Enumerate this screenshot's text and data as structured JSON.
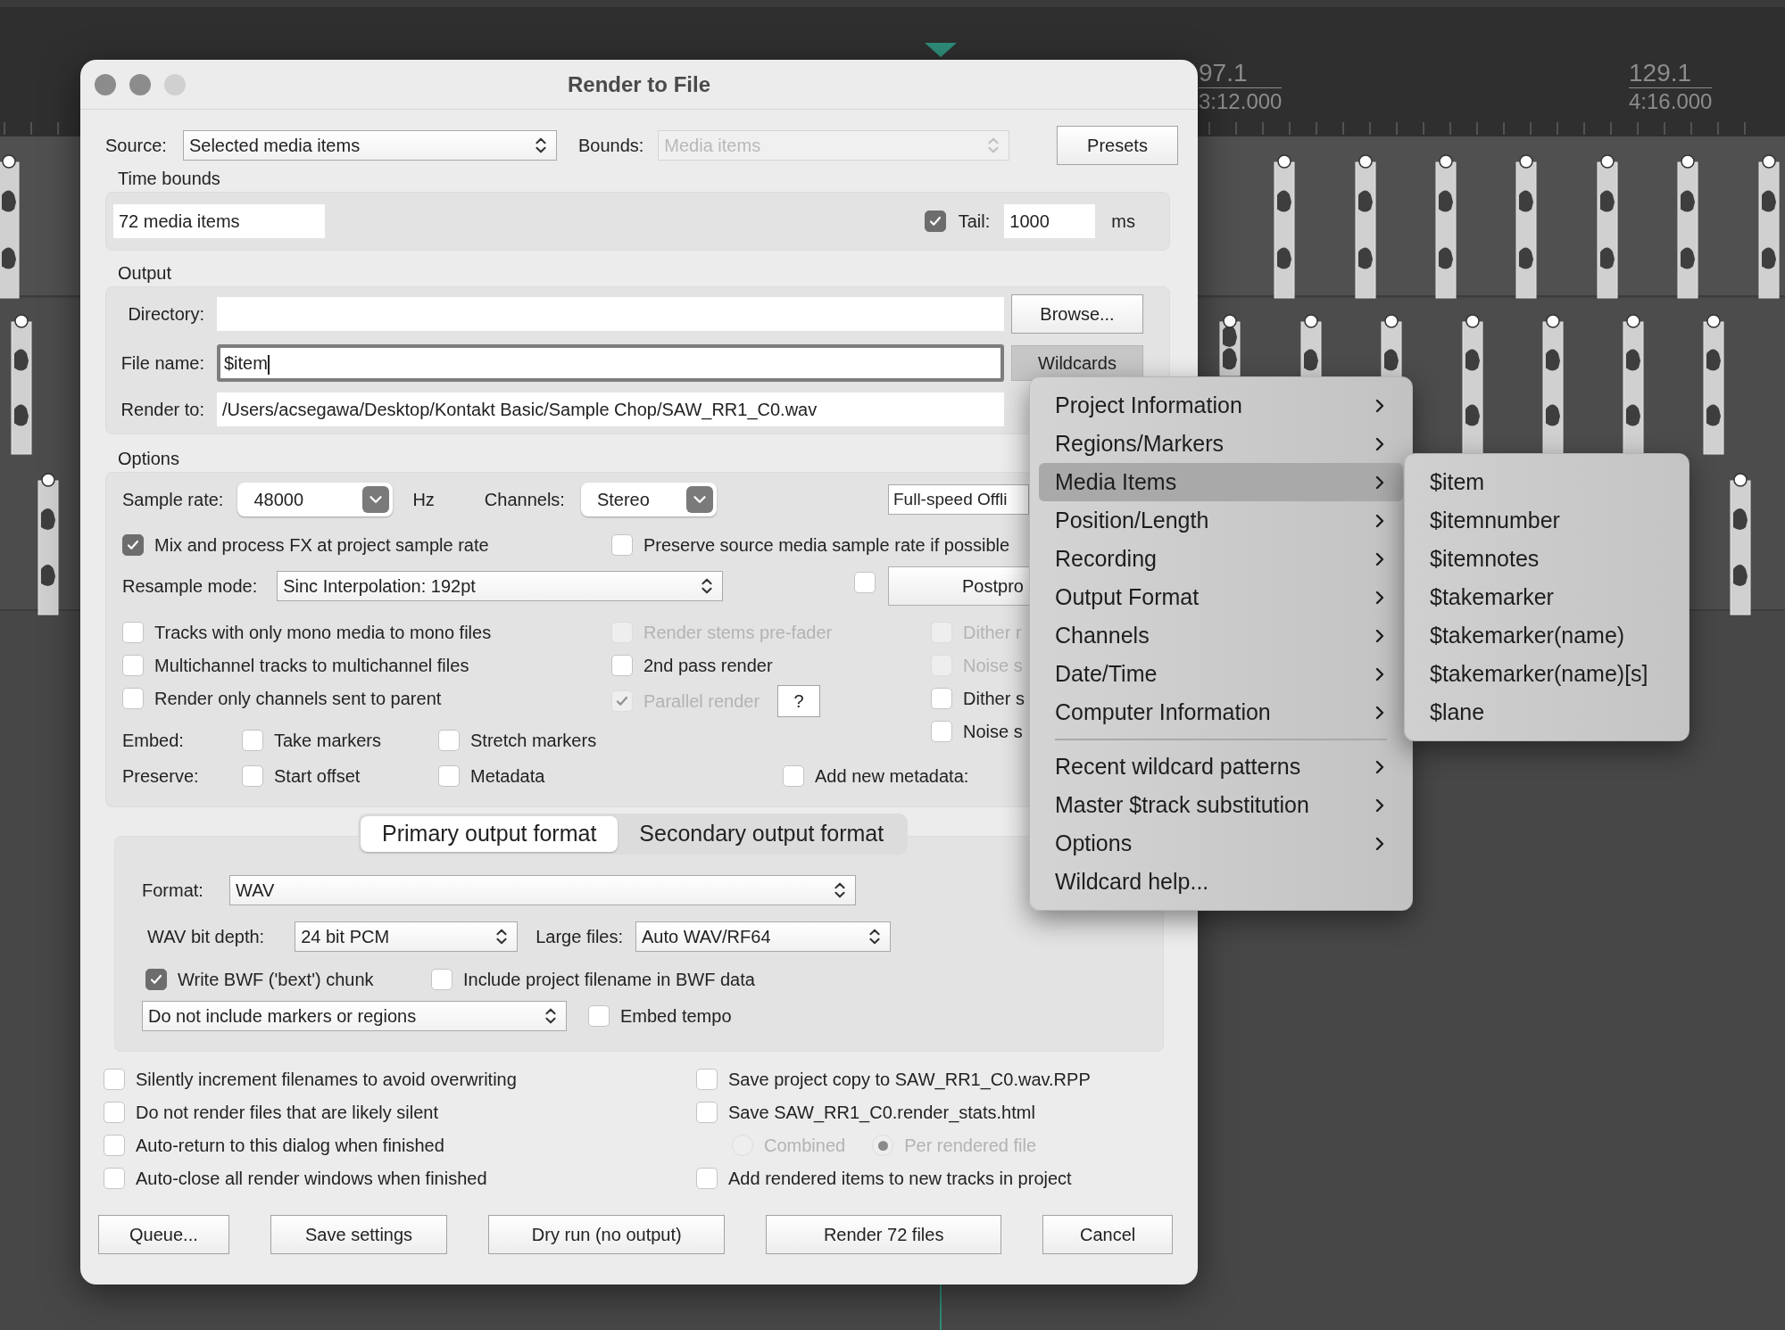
{
  "timeline": {
    "markers": [
      {
        "bar": "97.1",
        "time": "3:12.000"
      },
      {
        "bar": "129.1",
        "time": "4:16.000"
      }
    ]
  },
  "dialog": {
    "title": "Render to File",
    "source": {
      "label": "Source:",
      "value": "Selected media items"
    },
    "bounds": {
      "label": "Bounds:",
      "value": "Media items",
      "disabled": true
    },
    "presets_button": "Presets",
    "time_bounds": {
      "heading": "Time bounds",
      "range": "72 media items",
      "tail": {
        "label": "Tail:",
        "checked": true,
        "value": "1000",
        "unit": "ms"
      }
    },
    "output": {
      "heading": "Output",
      "directory": {
        "label": "Directory:"
      },
      "browse_button": "Browse...",
      "file_name": {
        "label": "File name:",
        "value": "$item"
      },
      "wildcards_button": "Wildcards",
      "render_to": {
        "label": "Render to:",
        "value": "/Users/acsegawa/Desktop/Kontakt Basic/Sample Chop/SAW_RR1_C0.wav"
      }
    },
    "options": {
      "heading": "Options",
      "sample_rate": {
        "label": "Sample rate:",
        "value": "48000",
        "unit": "Hz"
      },
      "channels": {
        "label": "Channels:",
        "value": "Stereo"
      },
      "speed": "Full-speed Offli",
      "mix_fx": {
        "label": "Mix and process FX at project sample rate",
        "checked": true,
        "disabled": false
      },
      "preserve_rate": {
        "label": "Preserve source media sample rate if possible",
        "checked": false,
        "disabled": false
      },
      "resample": {
        "label": "Resample mode:",
        "value": "Sinc Interpolation: 192pt"
      },
      "postprocess": {
        "label": "Postpro",
        "checked": false
      },
      "column_1": [
        {
          "label": "Tracks with only mono media to mono files",
          "checked": false,
          "disabled": false
        },
        {
          "label": "Multichannel tracks to multichannel files",
          "checked": false,
          "disabled": false
        },
        {
          "label": "Render only channels sent to parent",
          "checked": false,
          "disabled": false
        }
      ],
      "column_2": [
        {
          "label": "Render stems pre-fader",
          "checked": false,
          "disabled": true
        },
        {
          "label": "2nd pass render",
          "checked": false,
          "disabled": false
        },
        {
          "label": "Parallel render",
          "checked": true,
          "disabled": true
        }
      ],
      "help_button": "?",
      "column_3": [
        {
          "label": "Dither r",
          "checked": false,
          "disabled": true
        },
        {
          "label": "Noise s",
          "checked": false,
          "disabled": true
        },
        {
          "label": "Dither s",
          "checked": false,
          "disabled": false
        },
        {
          "label": "Noise s",
          "checked": false,
          "disabled": false
        }
      ],
      "embed": {
        "label": "Embed:",
        "items": [
          {
            "label": "Take markers",
            "checked": false,
            "disabled": false
          },
          {
            "label": "Stretch markers",
            "checked": false,
            "disabled": false
          }
        ]
      },
      "preserve": {
        "label": "Preserve:",
        "items": [
          {
            "label": "Start offset",
            "checked": false,
            "disabled": false
          },
          {
            "label": "Metadata",
            "checked": false,
            "disabled": false
          }
        ]
      },
      "add_metadata": {
        "label": "Add new metadata:",
        "checked": false,
        "disabled": false
      }
    },
    "format_tabs": [
      {
        "label": "Primary output format",
        "selected": true
      },
      {
        "label": "Secondary output format",
        "selected": false
      }
    ],
    "format": {
      "label": "Format:",
      "value": "WAV"
    },
    "bit_depth": {
      "label": "WAV bit depth:",
      "value": "24 bit PCM"
    },
    "large_files": {
      "label": "Large files:",
      "value": "Auto WAV/RF64"
    },
    "write_bwf": {
      "label": "Write BWF ('bext') chunk",
      "checked": true,
      "disabled": false
    },
    "include_filename": {
      "label": "Include project filename in BWF data",
      "checked": false,
      "disabled": false
    },
    "markers_mode": {
      "value": "Do not include markers or regions"
    },
    "embed_tempo": {
      "label": "Embed tempo",
      "checked": false,
      "disabled": false
    },
    "left_checks": [
      {
        "label": "Silently increment filenames to avoid overwriting",
        "checked": false,
        "disabled": false
      },
      {
        "label": "Do not render files that are likely silent",
        "checked": false,
        "disabled": false
      },
      {
        "label": "Auto-return to this dialog when finished",
        "checked": false,
        "disabled": false
      },
      {
        "label": "Auto-close all render windows when finished",
        "checked": false,
        "disabled": false
      }
    ],
    "save_copy": {
      "label": "Save project copy to SAW_RR1_C0.wav.RPP",
      "checked": false,
      "disabled": false
    },
    "save_stats": {
      "label": "Save SAW_RR1_C0.render_stats.html",
      "checked": false,
      "disabled": false
    },
    "stats_mode": [
      {
        "label": "Combined",
        "selected": false,
        "disabled": true
      },
      {
        "label": "Per rendered file",
        "selected": true,
        "disabled": true
      }
    ],
    "add_tracks": {
      "label": "Add rendered items to new tracks in project",
      "checked": false,
      "disabled": false
    },
    "buttons": [
      "Queue...",
      "Save settings",
      "Dry run (no output)",
      "Render 72 files",
      "Cancel"
    ]
  },
  "wildcards_menu": {
    "groups": [
      [
        {
          "label": "Project Information",
          "submenu": true,
          "selected": false
        },
        {
          "label": "Regions/Markers",
          "submenu": true,
          "selected": false
        },
        {
          "label": "Media Items",
          "submenu": true,
          "selected": true
        },
        {
          "label": "Position/Length",
          "submenu": true,
          "selected": false
        },
        {
          "label": "Recording",
          "submenu": true,
          "selected": false
        },
        {
          "label": "Output Format",
          "submenu": true,
          "selected": false
        },
        {
          "label": "Channels",
          "submenu": true,
          "selected": false
        },
        {
          "label": "Date/Time",
          "submenu": true,
          "selected": false
        },
        {
          "label": "Computer Information",
          "submenu": true,
          "selected": false
        }
      ],
      [
        {
          "label": "Recent wildcard patterns",
          "submenu": true,
          "selected": false
        },
        {
          "label": "Master $track substitution",
          "submenu": true,
          "selected": false
        },
        {
          "label": "Options",
          "submenu": true,
          "selected": false
        },
        {
          "label": "Wildcard help...",
          "submenu": false,
          "selected": false
        }
      ]
    ],
    "submenu": [
      "$item",
      "$itemnumber",
      "$itemnotes",
      "$takemarker",
      "$takemarker(name)",
      "$takemarker(name)[s]",
      "$lane"
    ]
  }
}
